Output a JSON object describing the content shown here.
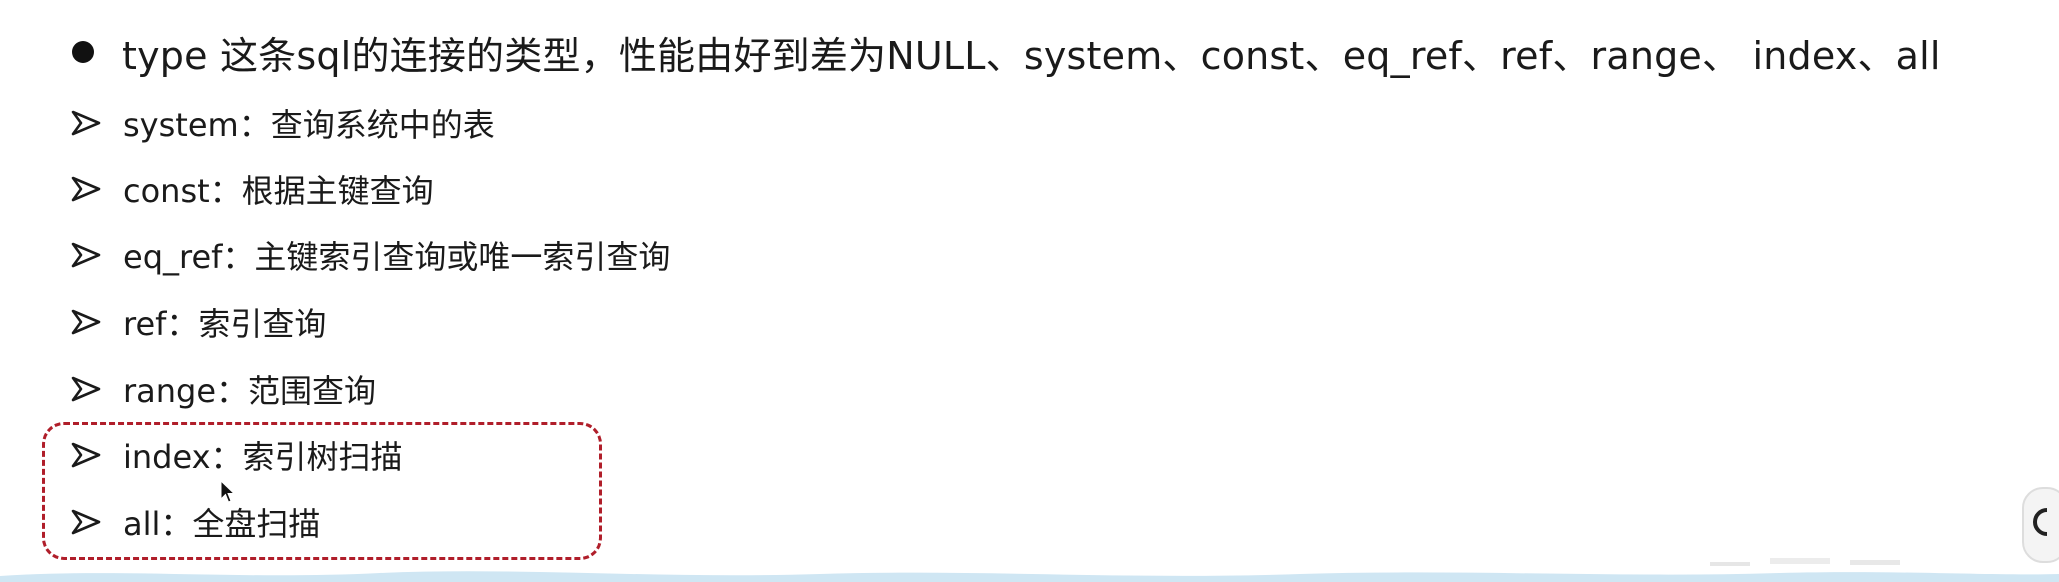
{
  "main_bullet": {
    "text": "type 这条sql的连接的类型，性能由好到差为NULL、system、const、eq_ref、ref、range、 index、all"
  },
  "items": [
    {
      "label": "system：查询系统中的表"
    },
    {
      "label": "const：根据主键查询"
    },
    {
      "label": "eq_ref：主键索引查询或唯一索引查询"
    },
    {
      "label": "ref：索引查询"
    },
    {
      "label": "range：范围查询"
    },
    {
      "label": "index：索引树扫描"
    },
    {
      "label": "all：全盘扫描"
    }
  ],
  "highlight": {
    "color": "#b01e2a"
  },
  "icons": {
    "bullet": "disc-bullet-icon",
    "item": "arrow-bullet-icon",
    "cursor": "mouse-pointer-icon"
  }
}
